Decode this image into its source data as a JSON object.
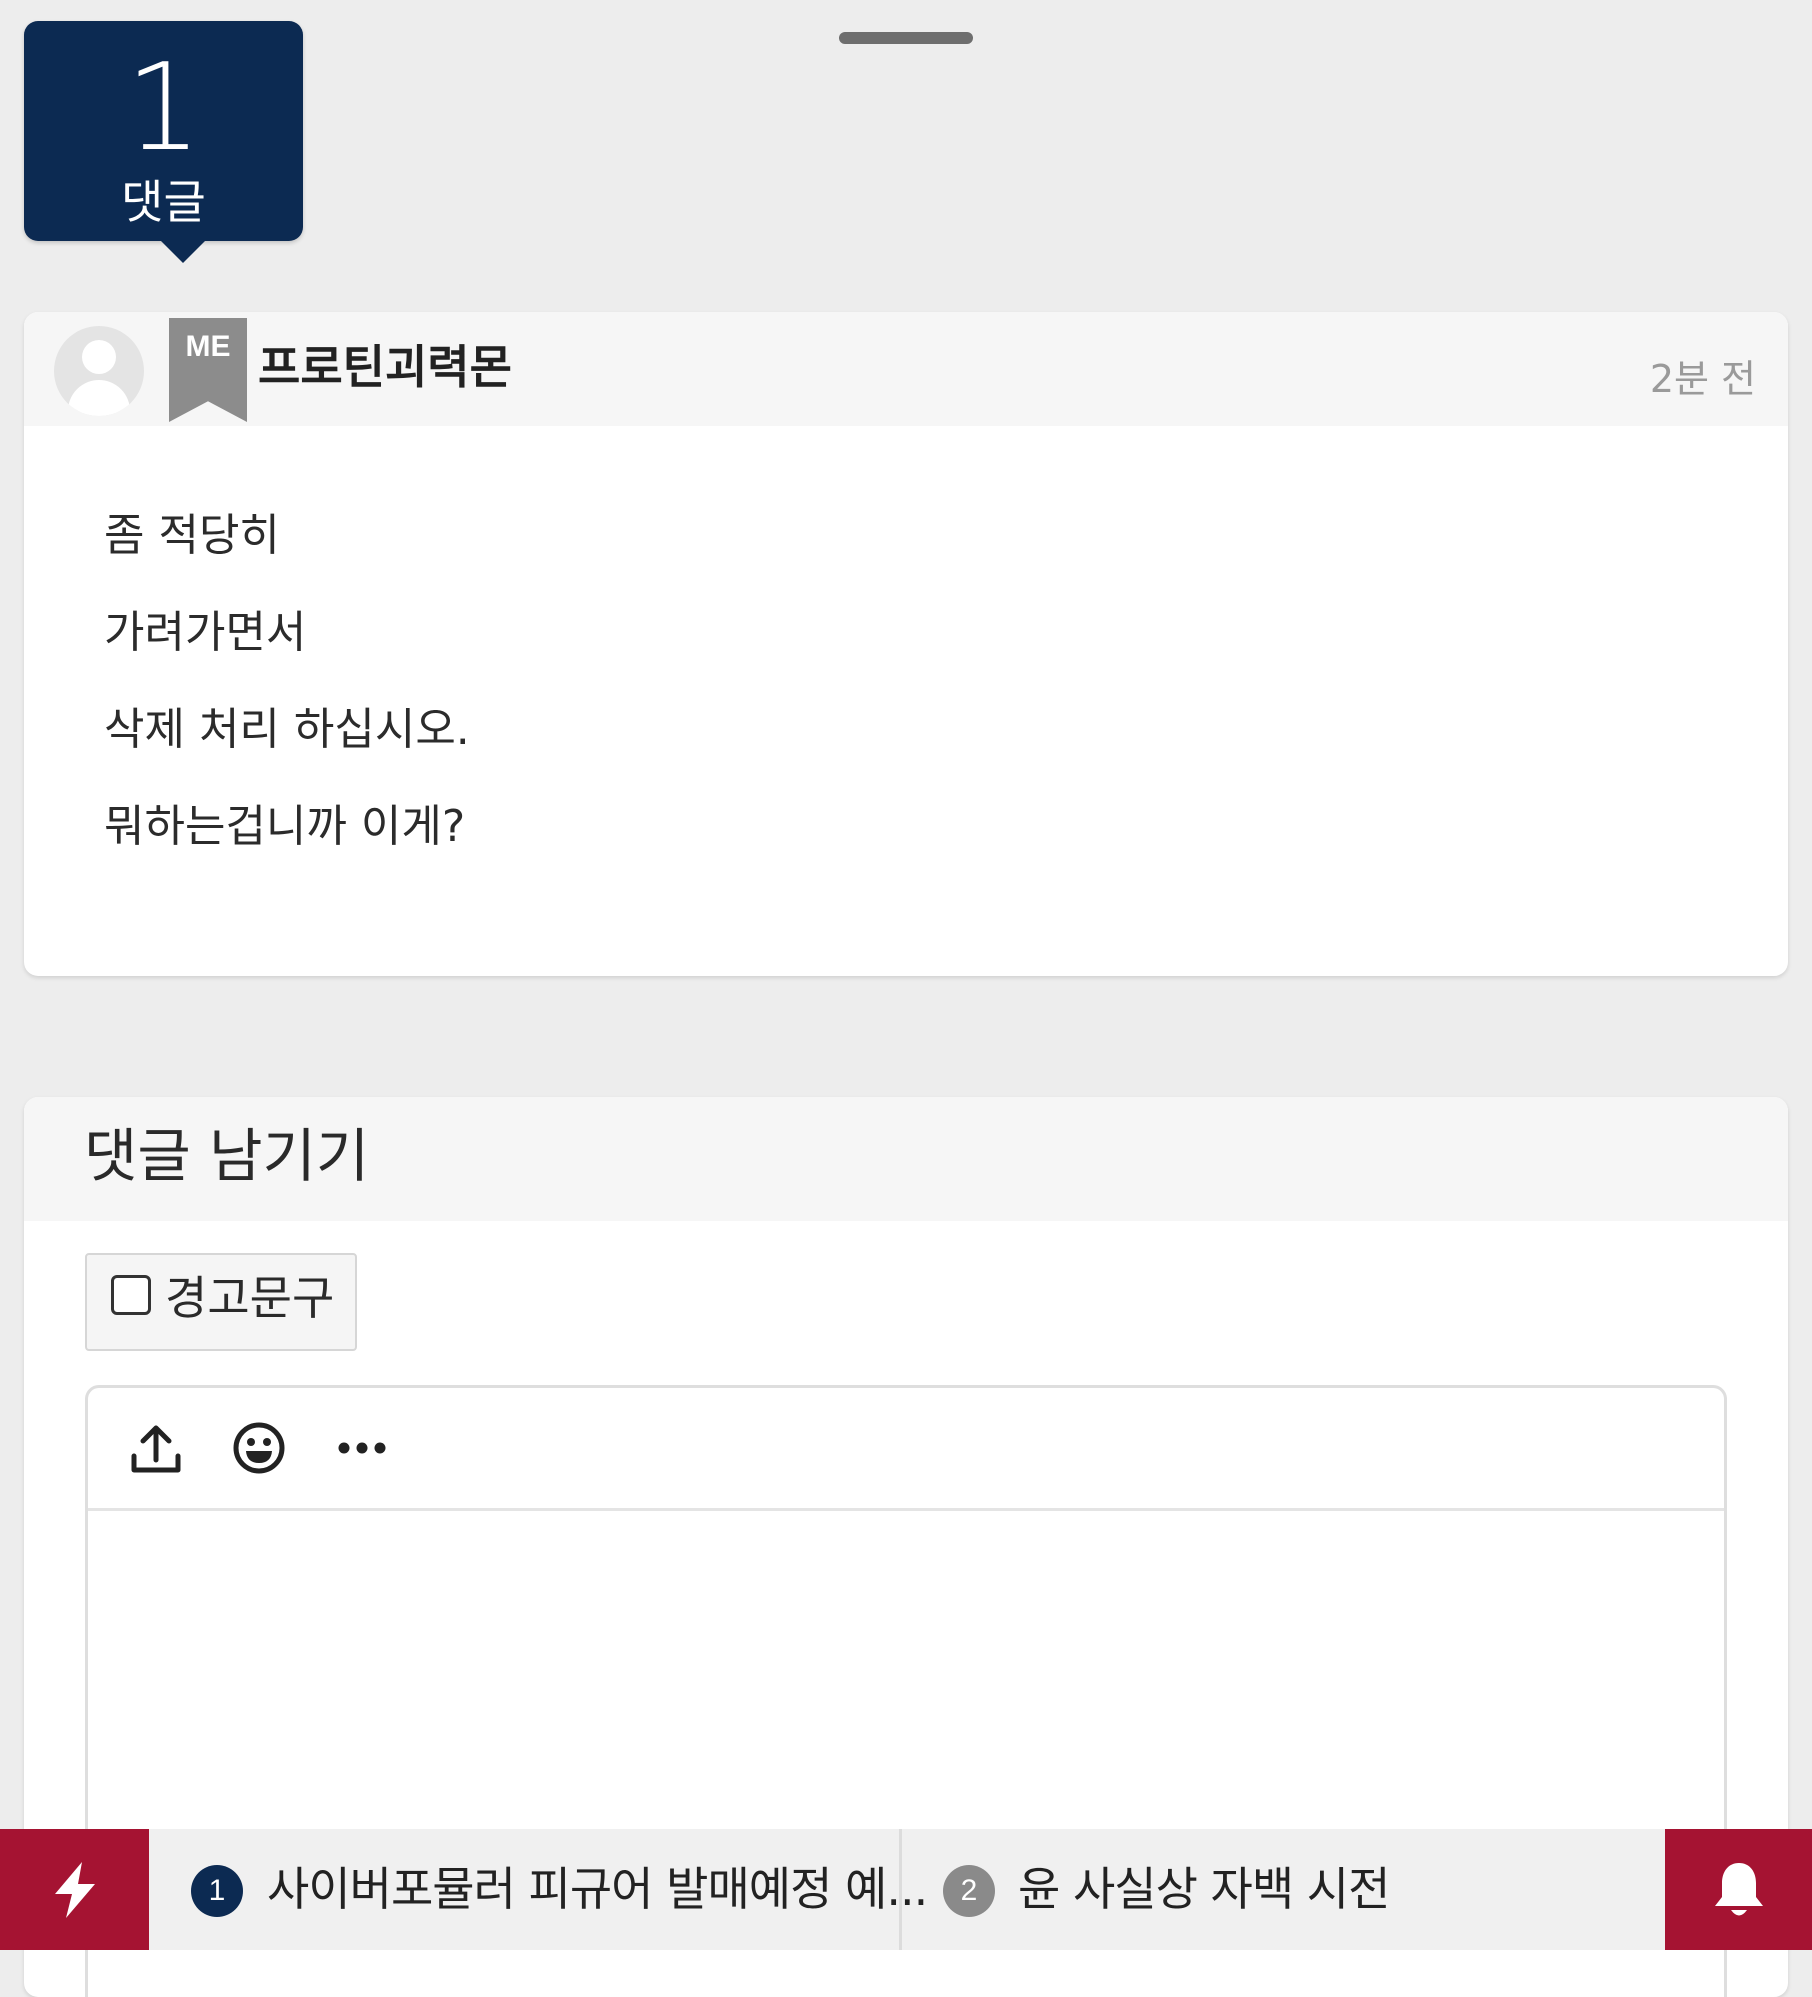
{
  "comments": {
    "count": "1",
    "label": "댓글"
  },
  "comment": {
    "badge": "ME",
    "author": "프로틴괴력몬",
    "time": "2분 전",
    "lines": [
      "좀 적당히",
      "가려가면서",
      "삭제 처리 하십시오.",
      "뭐하는겁니까 이게?"
    ]
  },
  "reply": {
    "title": "댓글 남기기",
    "warning_label": "경고문구",
    "toolbar": [
      "upload-icon",
      "emoji-icon",
      "more-icon"
    ]
  },
  "ticker": [
    {
      "rank": "1",
      "text": "사이버포뮬러 피규어 발매예정 예...",
      "color": "#0c2a52"
    },
    {
      "rank": "2",
      "text": "윤 사실상 자백 시전",
      "color": "#8a8a8a"
    }
  ],
  "colors": {
    "brand": "#0c2a52",
    "accent": "#a51332"
  }
}
